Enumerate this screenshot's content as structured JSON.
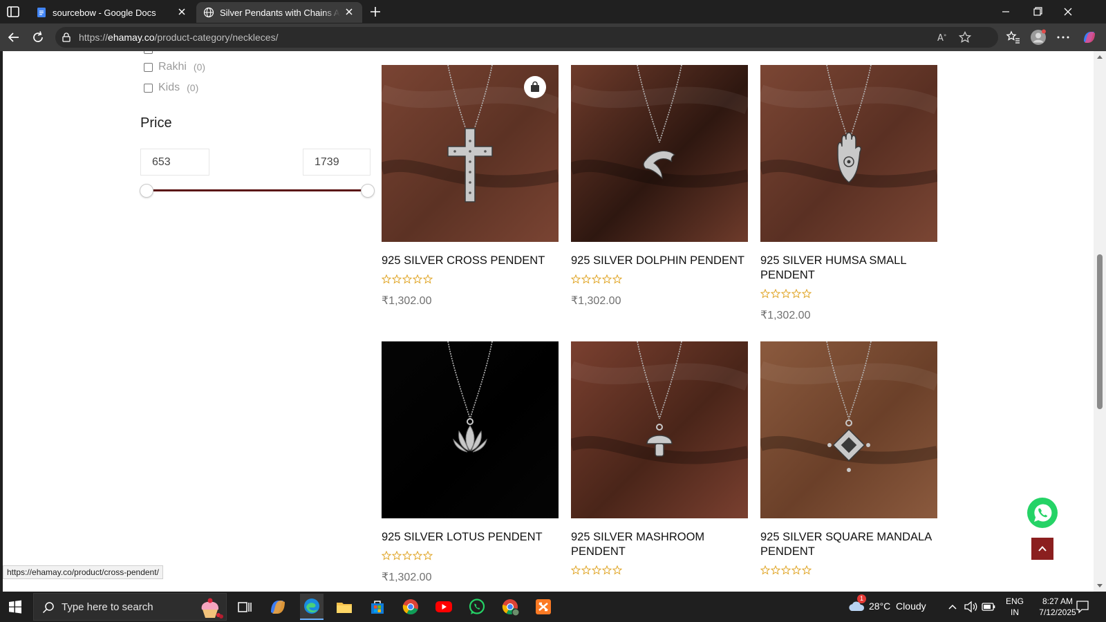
{
  "browser": {
    "tabs": [
      {
        "title": "sourcebow - Google Docs",
        "favicon": "google-docs-icon",
        "active": false
      },
      {
        "title": "Silver Pendants with Chains Archives",
        "favicon": "globe-icon",
        "active": true
      }
    ],
    "url_prefix": "https://",
    "url_domain": "ehamay.co",
    "url_path": "/product-category/neckleces/",
    "status_link": "https://ehamay.co/product/cross-pendent/"
  },
  "filters": {
    "categories": [
      {
        "label": "Rakhi",
        "count": "(0)"
      },
      {
        "label": "Kids",
        "count": "(0)"
      }
    ],
    "price_title": "Price",
    "price_min": "653",
    "price_max": "1739"
  },
  "products": [
    {
      "name": "925 SILVER CROSS PENDENT",
      "price": "₹1,302.00",
      "rating": 0,
      "pendant": "cross",
      "bg": "#7a4433",
      "bg2": "#5c3224"
    },
    {
      "name": "925 SILVER DOLPHIN PENDENT",
      "price": "₹1,302.00",
      "rating": 0,
      "pendant": "dolphin",
      "bg": "#6e3b2b",
      "bg2": "#2e1710"
    },
    {
      "name": "925 SILVER HUMSA SMALL PENDENT",
      "price": "₹1,302.00",
      "rating": 0,
      "pendant": "hamsa",
      "bg": "#7b4634",
      "bg2": "#5a3023"
    },
    {
      "name": "925 SILVER LOTUS PENDENT",
      "price": "₹1,302.00",
      "rating": 0,
      "pendant": "lotus",
      "bg": "#050505",
      "bg2": "#000000"
    },
    {
      "name": "925 SILVER MASHROOM PENDENT",
      "price": "",
      "rating": 0,
      "pendant": "mushroom",
      "bg": "#7a4030",
      "bg2": "#4a2519"
    },
    {
      "name": "925 SILVER SQUARE MANDALA PENDENT",
      "price": "",
      "rating": 0,
      "pendant": "mandala",
      "bg": "#8b5a3e",
      "bg2": "#6b4029"
    }
  ],
  "taskbar": {
    "search_placeholder": "Type here to search",
    "weather": "28°C  Cloudy",
    "weather_badge": "1",
    "lang": "ENG",
    "region": "IN",
    "time": "8:27 AM",
    "date": "7/12/2025"
  },
  "colors": {
    "brand_maroon": "#8b1f1f",
    "slider": "#5a1010",
    "star": "#e0a526",
    "whatsapp": "#25d366"
  }
}
